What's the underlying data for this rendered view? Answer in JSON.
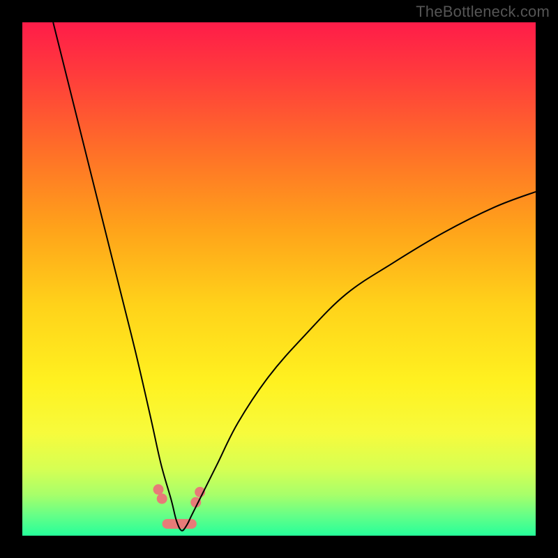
{
  "watermark": "TheBottleneck.com",
  "colors": {
    "frame": "#000000",
    "watermark": "#555555",
    "curve": "#000000",
    "cluster_fill": "#e77b78",
    "cluster_stroke": "#d96763",
    "gradient_stops": [
      {
        "offset": 0.0,
        "color": "#ff1c49"
      },
      {
        "offset": 0.1,
        "color": "#ff3b3c"
      },
      {
        "offset": 0.25,
        "color": "#ff6f28"
      },
      {
        "offset": 0.4,
        "color": "#ffa21a"
      },
      {
        "offset": 0.55,
        "color": "#ffd21a"
      },
      {
        "offset": 0.7,
        "color": "#fff120"
      },
      {
        "offset": 0.8,
        "color": "#f7fb3c"
      },
      {
        "offset": 0.87,
        "color": "#d6ff53"
      },
      {
        "offset": 0.92,
        "color": "#a8ff6a"
      },
      {
        "offset": 0.96,
        "color": "#66ff87"
      },
      {
        "offset": 1.0,
        "color": "#26ff9a"
      }
    ]
  },
  "chart_data": {
    "type": "line",
    "title": "",
    "xlabel": "",
    "ylabel": "",
    "xlim": [
      0,
      100
    ],
    "ylim": [
      0,
      100
    ],
    "grid": false,
    "legend": false,
    "note": "V-shaped optimum curve on rainbow gradient background; minimum near x≈31, approaches 0. Right arm rises with decreasing slope; curve exits right edge near y≈67.",
    "series": [
      {
        "name": "bottleneck-curve",
        "x": [
          6,
          10,
          14,
          18,
          22,
          25,
          27,
          29,
          30,
          31,
          32,
          33,
          35,
          38,
          42,
          48,
          55,
          63,
          72,
          82,
          92,
          100
        ],
        "y": [
          100,
          84,
          68,
          52,
          36,
          23,
          14,
          7,
          3,
          1,
          2,
          4,
          8,
          14,
          22,
          31,
          39,
          47,
          53,
          59,
          64,
          67
        ]
      }
    ],
    "cluster_points": {
      "name": "highlighted-points-near-minimum",
      "note": "Small salmon dots and a short salmon segment marking the trough region.",
      "points": [
        {
          "x": 26.5,
          "y": 9.0
        },
        {
          "x": 27.2,
          "y": 7.2
        },
        {
          "x": 33.8,
          "y": 6.5
        },
        {
          "x": 34.6,
          "y": 8.5
        }
      ],
      "base_segment": {
        "x0": 28.2,
        "y0": 2.3,
        "x1": 33.0,
        "y1": 2.3
      }
    }
  }
}
